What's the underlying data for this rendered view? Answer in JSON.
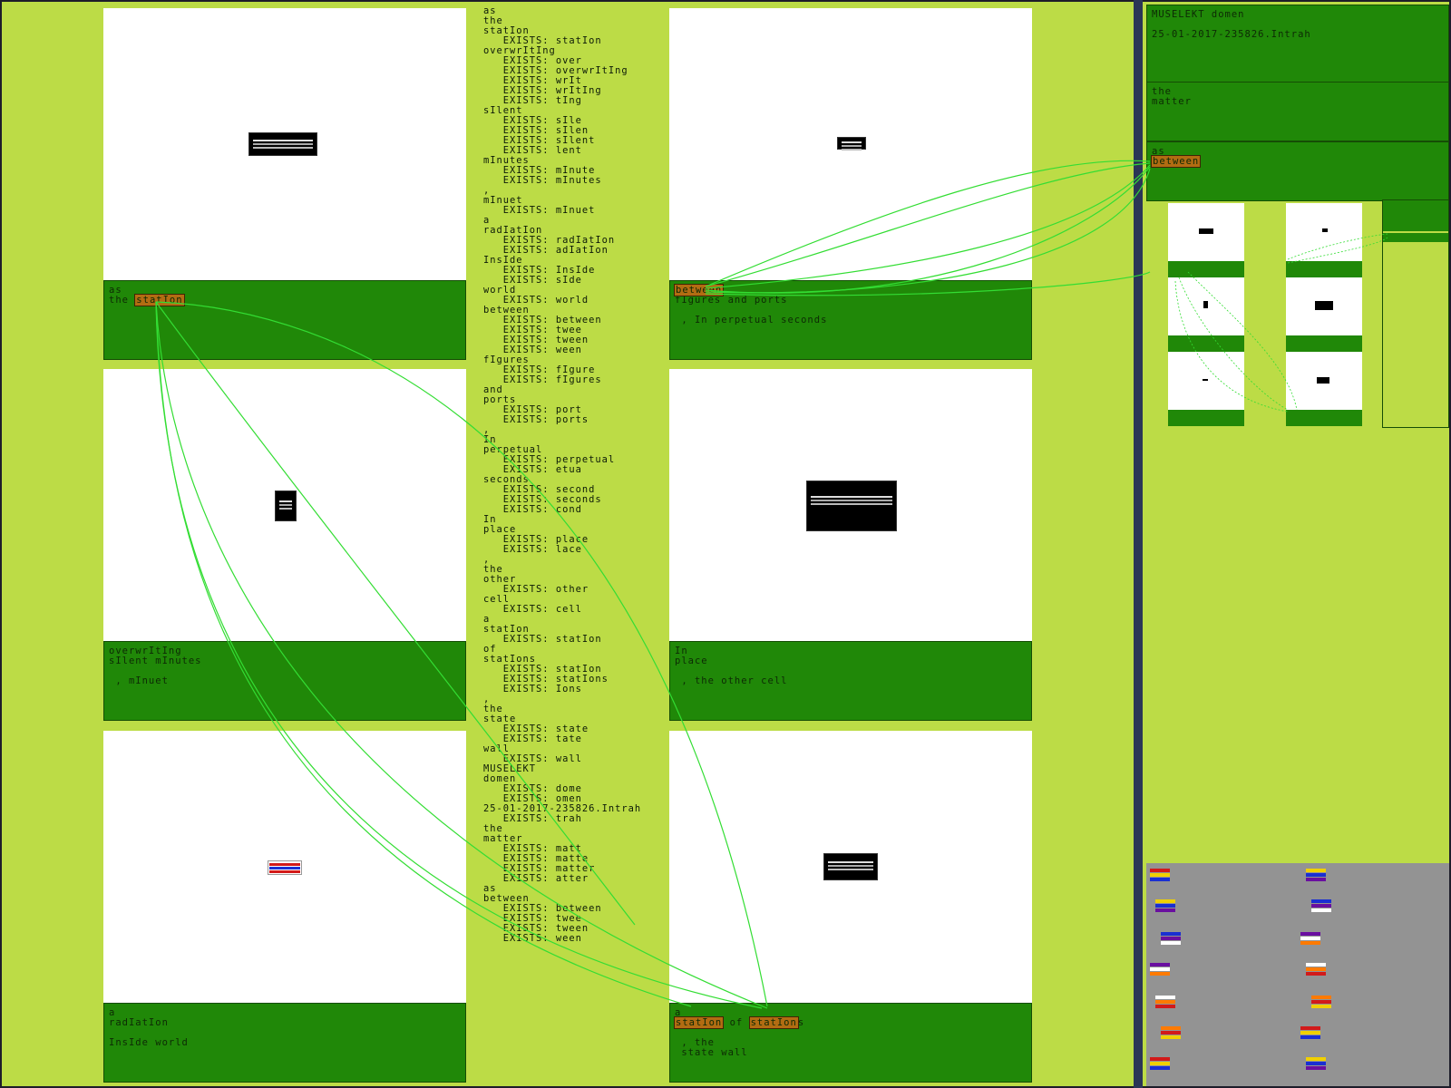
{
  "app": {
    "background": "#bcdc46",
    "caption_green": "#208808",
    "highlight": "#b26c12",
    "link_color": "#33dd33"
  },
  "cards": [
    {
      "name": "card-station",
      "caption": [
        "as",
        "the "
      ],
      "highlight": "statIon",
      "highlight_line": 1
    },
    {
      "name": "card-between",
      "caption": [
        "",
        "fIgures and ports",
        "",
        " , In perpetual seconds"
      ],
      "highlight": "between",
      "highlight_line": 0
    },
    {
      "name": "card-overwriting",
      "caption": [
        "overwrItIng",
        "sIlent mInutes",
        "",
        " , mInuet"
      ]
    },
    {
      "name": "card-place",
      "caption": [
        "In",
        "place",
        "",
        " , the other cell"
      ]
    },
    {
      "name": "card-radiation",
      "caption": [
        "a",
        "radIatIon",
        "",
        "InsIde world"
      ]
    },
    {
      "name": "card-stations",
      "caption": [
        "a",
        "",
        "",
        " , the",
        " state wall"
      ],
      "highlight": "statIon",
      "highlight2": "statIon",
      "mid": " of ",
      "tail": "s"
    }
  ],
  "center_text": [
    "as",
    "the",
    "statIon",
    "   EXISTS: statIon",
    "overwrItIng",
    "   EXISTS: over",
    "   EXISTS: overwrItIng",
    "   EXISTS: wrIt",
    "   EXISTS: wrItIng",
    "   EXISTS: tIng",
    "sIlent",
    "   EXISTS: sIle",
    "   EXISTS: sIlen",
    "   EXISTS: sIlent",
    "   EXISTS: lent",
    "mInutes",
    "   EXISTS: mInute",
    "   EXISTS: mInutes",
    ",",
    "mInuet",
    "   EXISTS: mInuet",
    "a",
    "radIatIon",
    "   EXISTS: radIatIon",
    "   EXISTS: adIatIon",
    "InsIde",
    "   EXISTS: InsIde",
    "   EXISTS: sIde",
    "world",
    "   EXISTS: world",
    "between",
    "   EXISTS: between",
    "   EXISTS: twee",
    "   EXISTS: tween",
    "   EXISTS: ween",
    "fIgures",
    "   EXISTS: fIgure",
    "   EXISTS: fIgures",
    "and",
    "ports",
    "   EXISTS: port",
    "   EXISTS: ports",
    ",",
    "In",
    "perpetual",
    "   EXISTS: perpetual",
    "   EXISTS: etua",
    "seconds",
    "   EXISTS: second",
    "   EXISTS: seconds",
    "   EXISTS: cond",
    "In",
    "place",
    "   EXISTS: place",
    "   EXISTS: lace",
    ",",
    "the",
    "other",
    "   EXISTS: other",
    "cell",
    "   EXISTS: cell",
    "a",
    "statIon",
    "   EXISTS: statIon",
    "of",
    "statIons",
    "   EXISTS: statIon",
    "   EXISTS: statIons",
    "   EXISTS: Ions",
    ",",
    "the",
    "state",
    "   EXISTS: state",
    "   EXISTS: tate",
    "wall",
    "   EXISTS: wall",
    "MUSELEKT",
    "domen",
    "   EXISTS: dome",
    "   EXISTS: omen",
    "25-01-2017-235826.Intrah",
    "   EXISTS: trah",
    "the",
    "matter",
    "   EXISTS: matt",
    "   EXISTS: matte",
    "   EXISTS: matter",
    "   EXISTS: atter",
    "as",
    "between",
    "   EXISTS: between",
    "   EXISTS: twee",
    "   EXISTS: tween",
    "   EXISTS: ween"
  ],
  "right_panel": {
    "box1": [
      "MUSELEKT domen",
      "",
      "25-01-2017-235826.Intrah"
    ],
    "box2": [
      "the",
      "matter"
    ],
    "box3_line": "as",
    "box3_highlight": "between"
  }
}
